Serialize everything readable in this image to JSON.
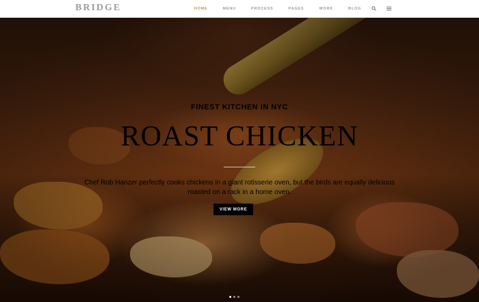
{
  "header": {
    "logo_text": "BRIDGE",
    "nav": [
      {
        "label": "HOME",
        "active": true
      },
      {
        "label": "MENU",
        "active": false
      },
      {
        "label": "PROCESS",
        "active": false
      },
      {
        "label": "PAGES",
        "active": false
      },
      {
        "label": "WORK",
        "active": false
      },
      {
        "label": "BLOG",
        "active": false
      }
    ],
    "icons": [
      "search-icon",
      "menu-icon"
    ],
    "accent_color": "#d98c3a"
  },
  "hero": {
    "subtitle": "FINEST KITCHEN IN NYC",
    "title": "ROAST CHICKEN",
    "description": "Chef Rob Hanzer perfectly cooks chickens in a giant rotisserie oven, but the birds are equally delicious roasted on a rack in a home oven.",
    "button_label": "VIEW MORE",
    "slides_total": 3,
    "active_slide": 1
  }
}
